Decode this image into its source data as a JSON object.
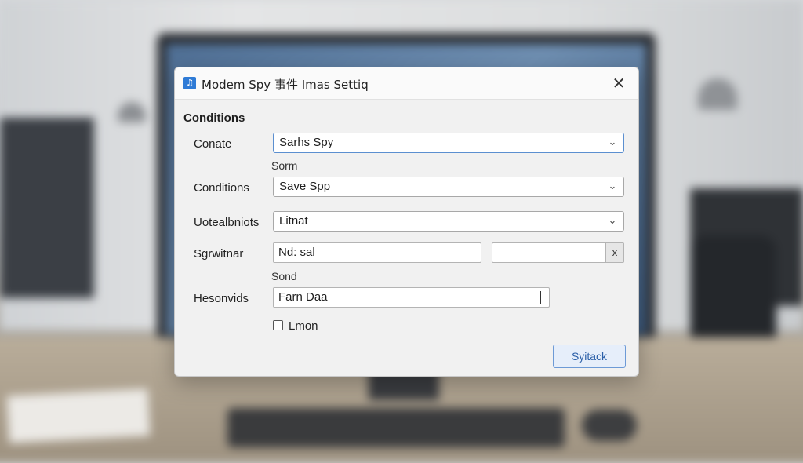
{
  "window": {
    "title": "Modem Spy 事件 Imas Settiq",
    "icon": "music-note-icon",
    "close_label": "✕"
  },
  "conditions": {
    "section_title": "Conditions",
    "rows": [
      {
        "label": "Conate",
        "value": "Sarhs Spy",
        "type": "dropdown"
      },
      {
        "label": "Conditions",
        "value": "Save Spp",
        "type": "dropdown"
      },
      {
        "label": "Uotealbniots",
        "value": "Litnat",
        "type": "dropdown"
      },
      {
        "label": "Sgrwitnar",
        "value": "Nd: sal",
        "type": "text"
      },
      {
        "label": "Hesonvids",
        "value": "Farn Daa",
        "type": "text"
      }
    ],
    "sublabel_1": "Sorm",
    "sublabel_2": "Sond",
    "second_field_value": "",
    "clear_label": "x",
    "checkbox_label": "Lmon",
    "checkbox_checked": false
  },
  "actions": {
    "primary_label": "Syitack"
  },
  "chevron": "⌄"
}
